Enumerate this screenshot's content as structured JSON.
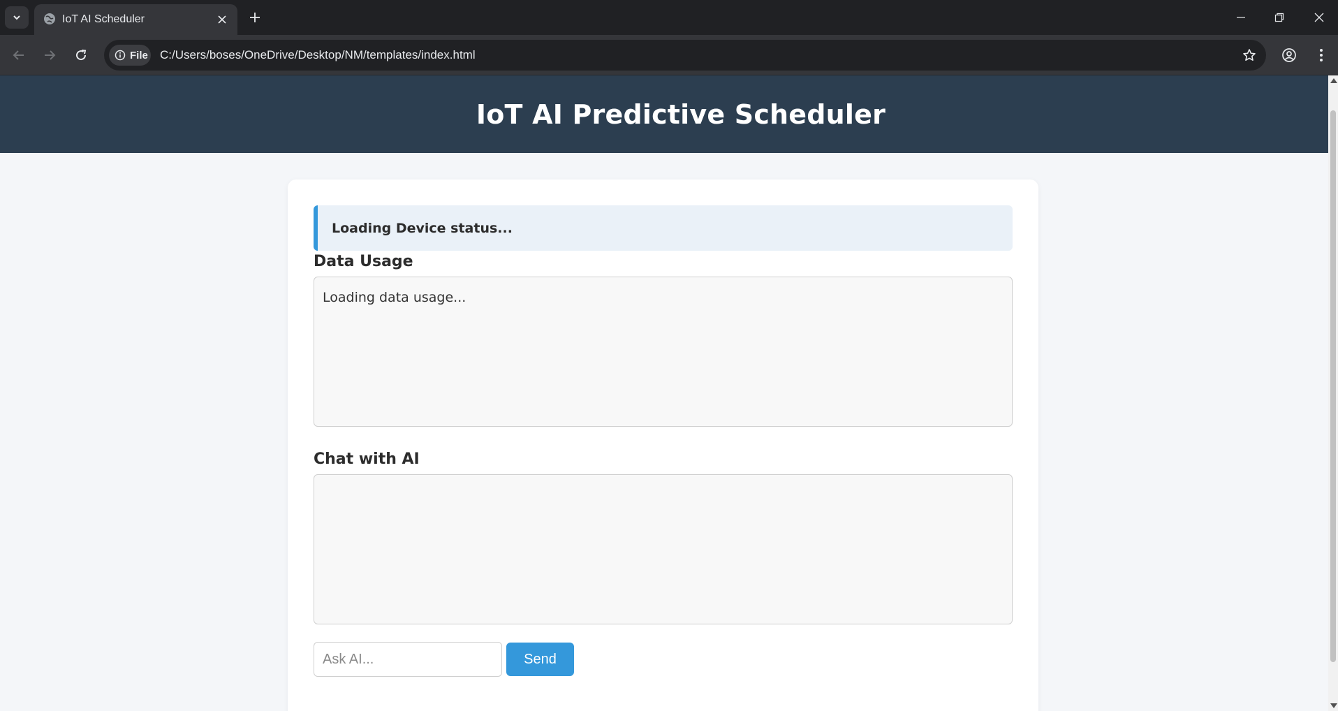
{
  "browser": {
    "tab_title": "IoT AI Scheduler",
    "site_chip": "File",
    "url": "C:/Users/boses/OneDrive/Desktop/NM/templates/index.html"
  },
  "page": {
    "title": "IoT AI Predictive Scheduler",
    "device_status": "Loading Device status...",
    "data_usage": {
      "heading": "Data Usage",
      "content": "Loading data usage..."
    },
    "chat": {
      "heading": "Chat with AI",
      "content": "",
      "input_placeholder": "Ask AI...",
      "input_value": "",
      "send_label": "Send"
    }
  },
  "colors": {
    "header_bg": "#2c3e50",
    "accent": "#3498db",
    "status_bg": "#eaf1f8",
    "page_bg": "#f4f6f9"
  }
}
